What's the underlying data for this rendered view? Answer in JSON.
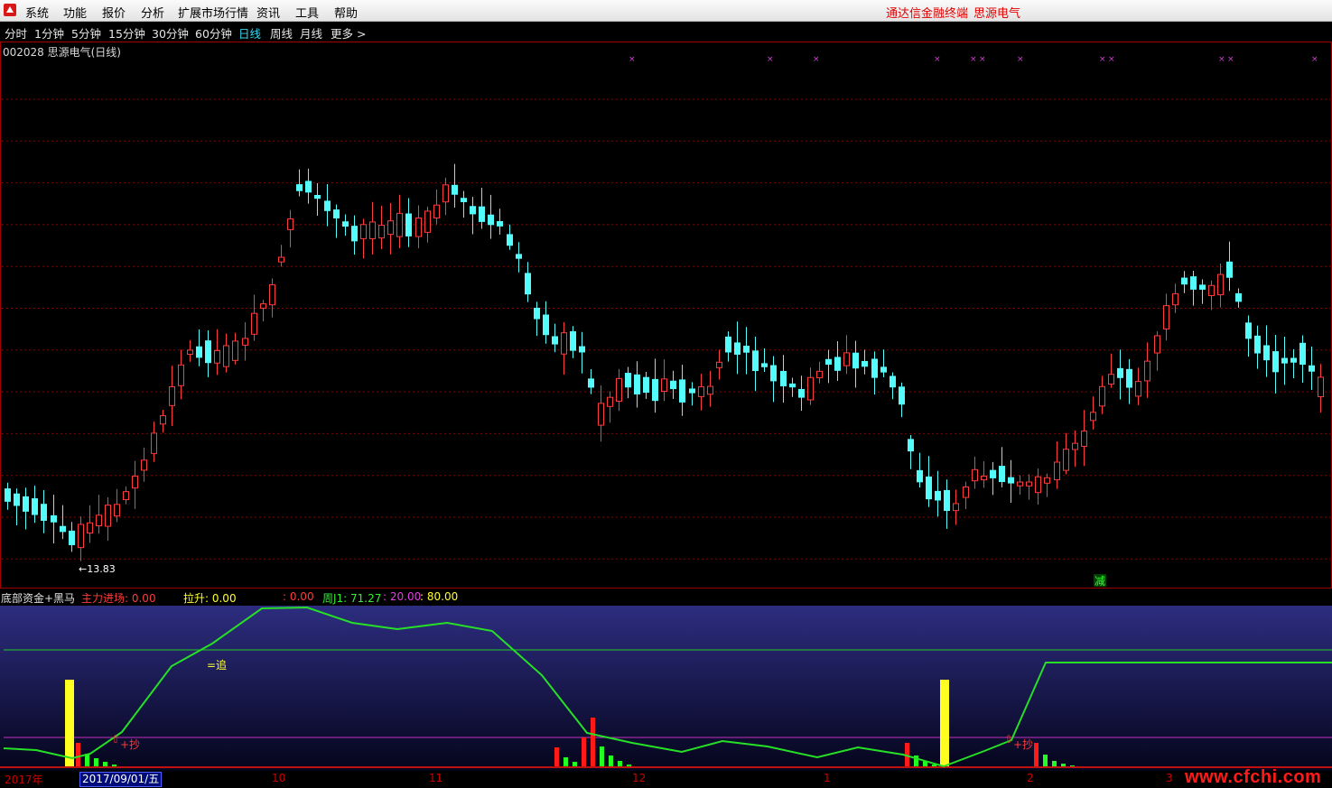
{
  "menu": {
    "items": [
      "系统",
      "功能",
      "报价",
      "分析",
      "扩展市场行情",
      "资讯",
      "工具",
      "帮助"
    ],
    "brand_terminal": "通达信金融终端",
    "brand_stock": "思源电气"
  },
  "periods": {
    "items": [
      "分时",
      "1分钟",
      "5分钟",
      "15分钟",
      "30分钟",
      "60分钟",
      "日线",
      "周线",
      "月线",
      "更多 >"
    ],
    "active_index": 6
  },
  "stock": {
    "code_name": "002028 思源电气(日线)"
  },
  "main_chart": {
    "low_label": "←13.83",
    "reduce_marker": "减",
    "marker_glyph": "×"
  },
  "indicator": {
    "name": "底部资金+黑马",
    "inflow": "主力进场: 0.00",
    "rise": "拉升: 0.00",
    "blank": ": 0.00",
    "week_j": "周J1: 71.27",
    "level_low": ": 20.00",
    "level_high": ": 80.00",
    "chase_label": "=追",
    "buy_label": "+抄"
  },
  "axis": {
    "year": "2017年",
    "cursor_date": "2017/09/01/五",
    "ticks": [
      "10",
      "11",
      "12",
      "1",
      "2",
      "3"
    ]
  },
  "colors": {
    "up": "#ff3b3b",
    "down": "#54fcfc",
    "grid": "#8b0000",
    "line": "#26e026"
  },
  "watermark": "www.cfchi.com"
}
